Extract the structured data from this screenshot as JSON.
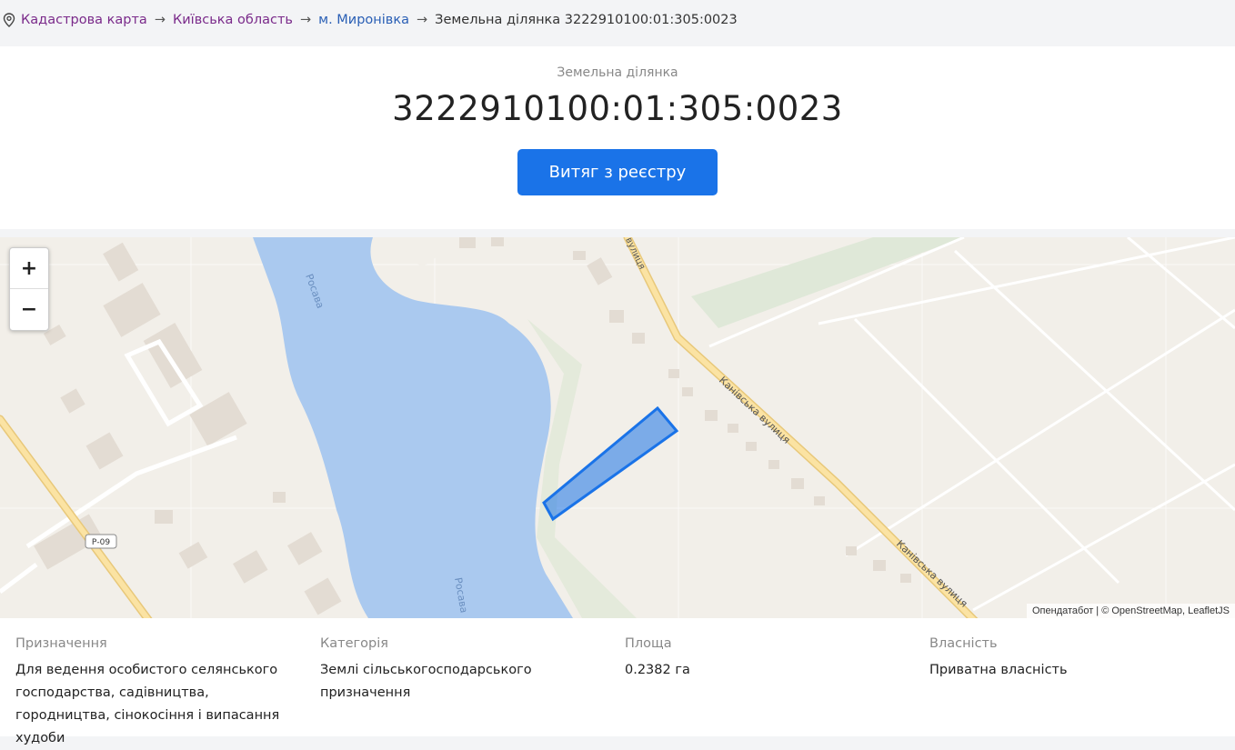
{
  "breadcrumb": {
    "icon": "location-pin-icon",
    "items": [
      {
        "label": "Кадастрова карта"
      },
      {
        "label": "Київська область"
      },
      {
        "label": "м. Миронівка"
      }
    ],
    "arrow": "→",
    "current": "Земельна ділянка 3222910100:01:305:0023"
  },
  "header": {
    "kicker": "Земельна ділянка",
    "number": "3222910100:01:305:0023",
    "button_label": "Витяг з реєстру",
    "accent": "#1a73e8"
  },
  "map": {
    "zoom_in": "+",
    "zoom_out": "−",
    "labels": {
      "river_top": "Росава",
      "river_bottom": "Росава",
      "street_1": "Канівська вулиця",
      "street_2": "Канівська вулиця",
      "route": "Р-09",
      "street_top": "вулиця"
    },
    "attribution": "Опендатабот | © OpenStreetMap, LeafletJS",
    "water_color": "#aac9ef",
    "parcel_color": "#1a73e8"
  },
  "info": {
    "purpose": {
      "label": "Призначення",
      "value": "Для ведення особистого селянського господарства, садівництва, городництва, сінокосіння і випасання худоби"
    },
    "category": {
      "label": "Категорія",
      "value": "Землі сільськогосподарського призначення"
    },
    "area": {
      "label": "Площа",
      "value": "0.2382 га"
    },
    "ownership": {
      "label": "Власність",
      "value": "Приватна власність"
    }
  }
}
